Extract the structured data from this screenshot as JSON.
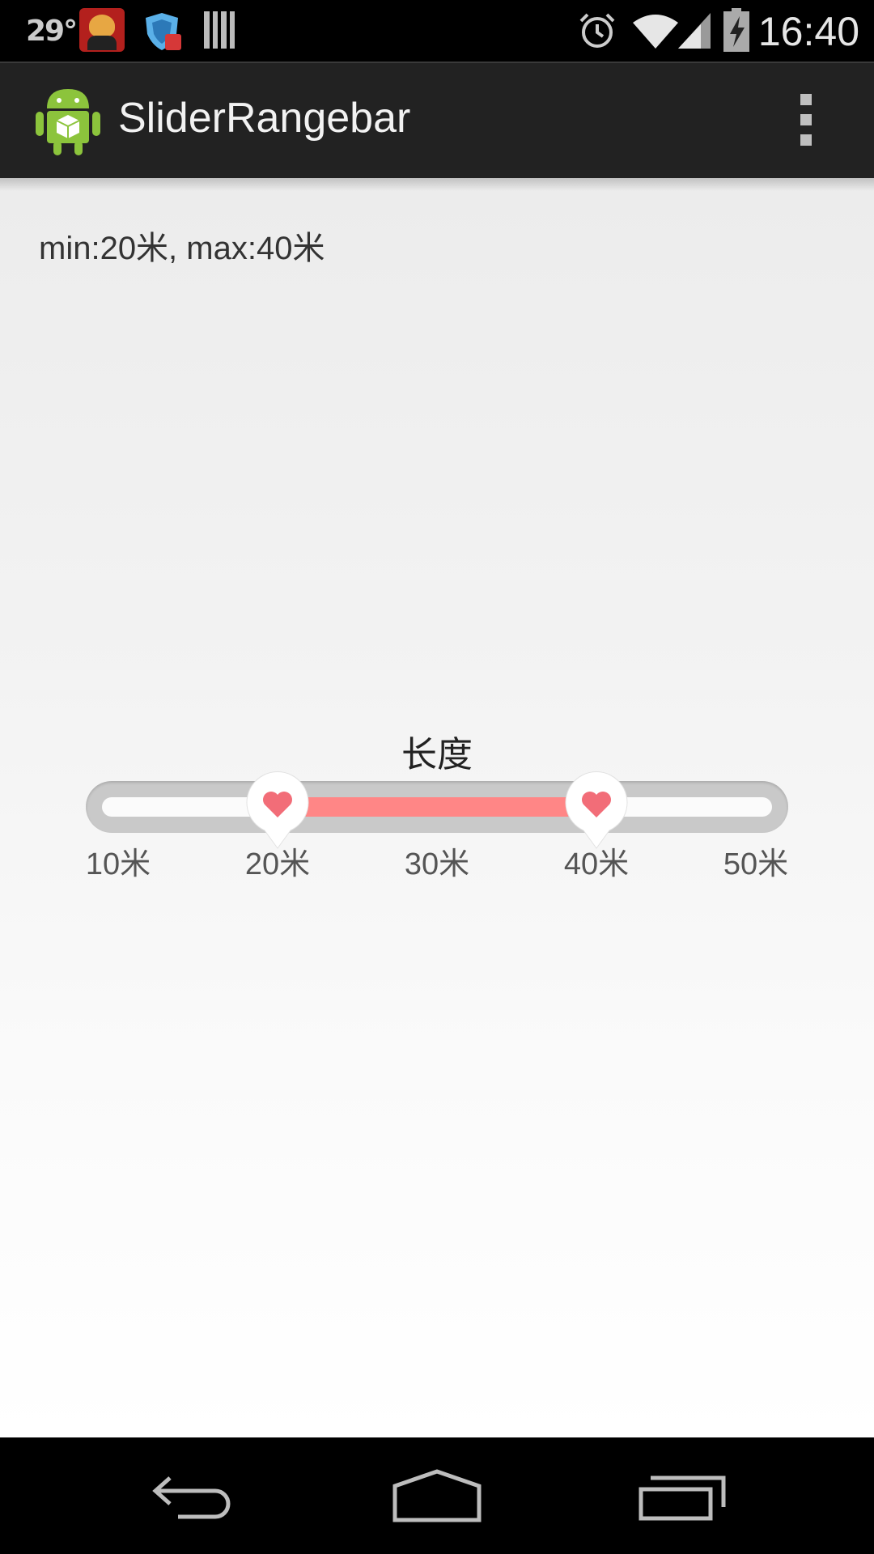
{
  "status_bar": {
    "temperature": "29°",
    "time": "16:40",
    "icons": [
      "bull-app-icon",
      "shield-app-icon",
      "barcode-icon",
      "alarm-icon",
      "wifi-icon",
      "signal-icon",
      "battery-charging-icon"
    ]
  },
  "action_bar": {
    "title": "SliderRangebar",
    "app_icon": "android-icon",
    "overflow_icon": "overflow-menu-icon"
  },
  "content": {
    "status_text": "min:20米, max:40米"
  },
  "slider": {
    "title": "长度",
    "ticks": [
      "10米",
      "20米",
      "30米",
      "40米",
      "50米"
    ],
    "min_value": 20,
    "max_value": 40,
    "range_start": 10,
    "range_end": 50,
    "thumb_icon": "heart-icon",
    "range_color": "#ff8686",
    "track_color": "#c9c9c9"
  },
  "nav_bar": {
    "icons": [
      "back-icon",
      "home-icon",
      "recents-icon"
    ]
  }
}
